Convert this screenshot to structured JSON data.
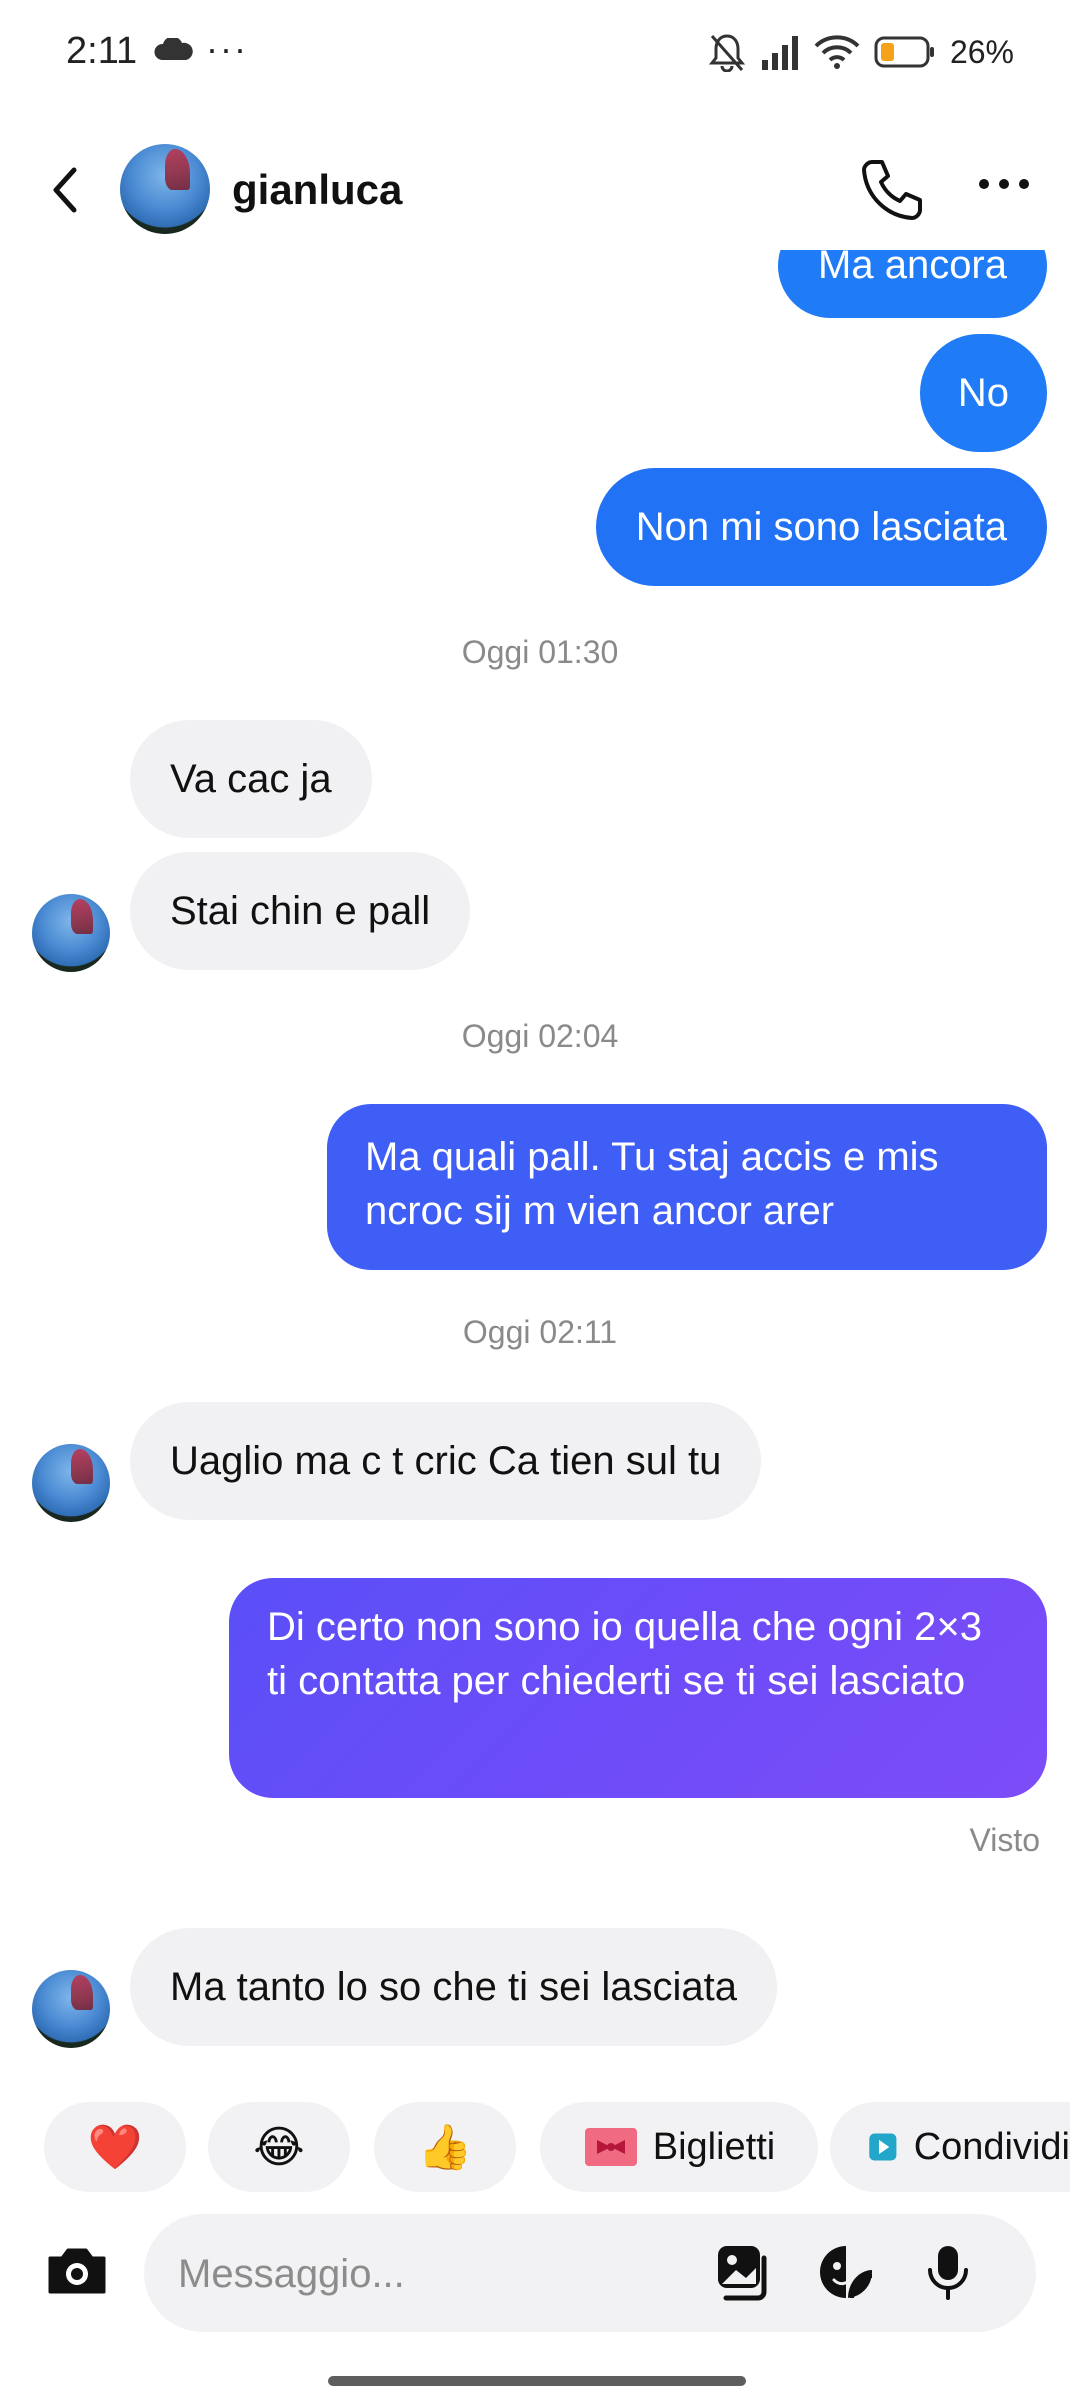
{
  "status_bar": {
    "time": "2:11",
    "battery": "26%",
    "icons": [
      "cloud-icon",
      "more-dots-icon",
      "bell-muted-icon",
      "signal-icon",
      "wifi-icon",
      "battery-icon"
    ]
  },
  "header": {
    "contact_name": "gianluca",
    "icons": [
      "back-arrow-icon",
      "phone-icon",
      "more-icon"
    ]
  },
  "messages": {
    "m0": "Ma ancora",
    "m1": "No",
    "m2": "Non mi sono lasciata",
    "ts1": "Oggi 01:30",
    "m3": "Va cac ja",
    "m4": "Stai chin e pall",
    "ts2": "Oggi 02:04",
    "m5": "Ma quali pall. Tu staj accis e mis ncroc sij m vien ancor arer",
    "ts3": "Oggi 02:11",
    "m6": "Uaglio ma c t cric Ca tien sul tu",
    "m7": "Di certo non sono io quella che ogni 2×3 ti contatta per chiederti se ti sei lasciato",
    "seen": "Visto",
    "m8": "Ma tanto lo so che ti sei lasciata"
  },
  "quick_replies": {
    "heart": "❤️",
    "laugh": "😂",
    "thumbs": "👍",
    "tickets": "Biglietti",
    "share": "Condividi"
  },
  "composer": {
    "placeholder": "Messaggio...",
    "icons": [
      "camera-icon",
      "gallery-icon",
      "sticker-icon",
      "microphone-icon"
    ]
  },
  "colors": {
    "outgoing_start": "#1f7bf6",
    "outgoing_mid": "#3f5ef6",
    "outgoing_end": "#7a4cf8",
    "incoming_bg": "#f1f1f3",
    "timestamp": "#8a8a8a"
  }
}
